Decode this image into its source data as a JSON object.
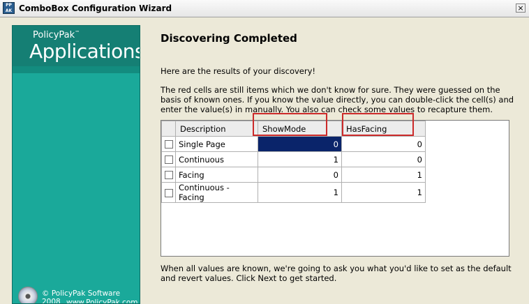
{
  "window": {
    "title": "ComboBox Configuration Wizard",
    "icon_text": "PP AK",
    "close_label": "×"
  },
  "sidebar": {
    "brand_small": "PolicyPak",
    "brand_tm": "™",
    "brand_large": "Applications",
    "copyright": "© PolicyPak Software 2008",
    "website": "www.PolicyPak.com"
  },
  "main": {
    "heading": "Discovering Completed",
    "intro": "Here are the results of your discovery!",
    "explain_line1": "The red cells are still items which we don't know for sure. They were guessed on the",
    "explain_line2": "basis of known ones. If you know the value directly, you can double-click the cell(s) and",
    "explain_line3": "enter the value(s) in manually. You also can check some values to recapture them.",
    "footer_line1": "When all values are known, we're going to ask you what you'd like to set as the default",
    "footer_line2": "and revert values. Click Next to get started."
  },
  "grid": {
    "headers": [
      "Description",
      "ShowMode",
      "HasFacing"
    ],
    "rows": [
      {
        "description": "Single Page",
        "showmode": "0",
        "hasfacing": "0"
      },
      {
        "description": "Continuous",
        "showmode": "1",
        "hasfacing": "0"
      },
      {
        "description": "Facing",
        "showmode": "0",
        "hasfacing": "1"
      },
      {
        "description": "Continuous - Facing",
        "showmode": "1",
        "hasfacing": "1"
      }
    ]
  },
  "colors": {
    "sidebar": "#1aa99a",
    "selection": "#0a246a",
    "highlight": "#cc2a2a"
  }
}
